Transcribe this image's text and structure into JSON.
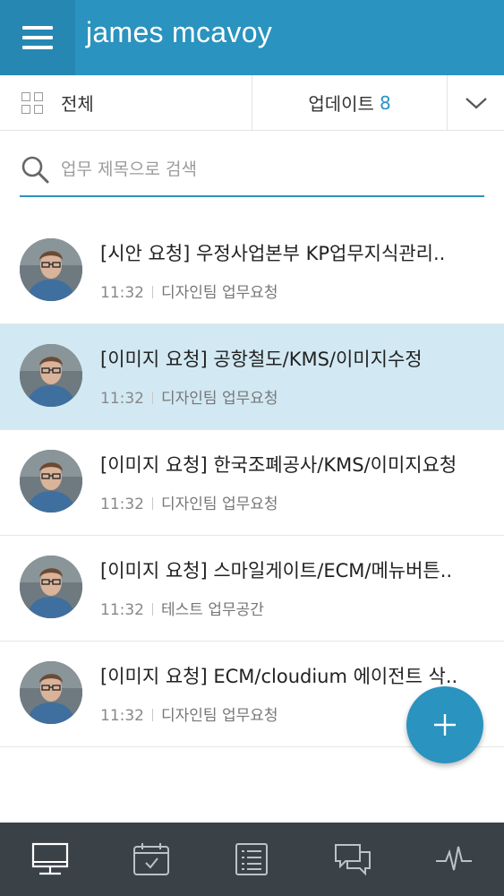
{
  "header": {
    "title": "james mcavoy",
    "menu_icon": "hamburger-icon",
    "color": "#2a93bf"
  },
  "filter": {
    "all_label": "전체",
    "all_icon": "grid-icon",
    "update_label": "업데이트",
    "update_count": "8",
    "toggle_icon": "chevron-down-icon"
  },
  "search": {
    "placeholder": "업무 제목으로 검색",
    "icon": "search-icon"
  },
  "tasks": [
    {
      "title": "[시안 요청] 우정사업본부 KP업무지식관리..",
      "time": "11:32",
      "team": "디자인팀 업무요청",
      "selected": false
    },
    {
      "title": "[이미지 요청] 공항철도/KMS/이미지수정",
      "time": "11:32",
      "team": "디자인팀 업무요청",
      "selected": true
    },
    {
      "title": "[이미지 요청] 한국조폐공사/KMS/이미지요청",
      "time": "11:32",
      "team": "디자인팀 업무요청",
      "selected": false
    },
    {
      "title": "[이미지 요청] 스마일게이트/ECM/메뉴버튼..",
      "time": "11:32",
      "team": "테스트 업무공간",
      "selected": false
    },
    {
      "title": "[이미지 요청] ECM/cloudium 에이전트 삭..",
      "time": "11:32",
      "team": "디자인팀 업무요청",
      "selected": false
    }
  ],
  "fab": {
    "icon": "plus-icon"
  },
  "bottom_nav": {
    "items": [
      {
        "icon": "desktop-icon",
        "active": true
      },
      {
        "icon": "calendar-check-icon",
        "active": false
      },
      {
        "icon": "list-icon",
        "active": false
      },
      {
        "icon": "chat-icon",
        "active": false
      },
      {
        "icon": "activity-icon",
        "active": false
      }
    ],
    "background": "#3a4248",
    "active_color": "#2a93bf"
  }
}
